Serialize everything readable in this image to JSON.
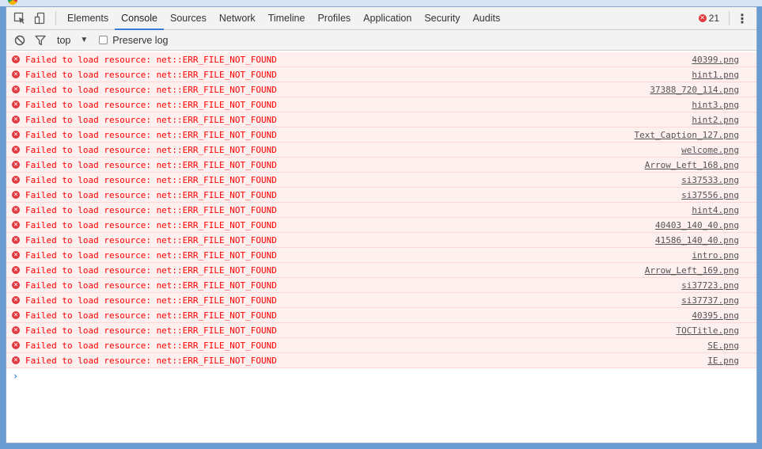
{
  "tabbar": {
    "tabs": [
      {
        "label": "Elements",
        "active": false
      },
      {
        "label": "Console",
        "active": true
      },
      {
        "label": "Sources",
        "active": false
      },
      {
        "label": "Network",
        "active": false
      },
      {
        "label": "Timeline",
        "active": false
      },
      {
        "label": "Profiles",
        "active": false
      },
      {
        "label": "Application",
        "active": false
      },
      {
        "label": "Security",
        "active": false
      },
      {
        "label": "Audits",
        "active": false
      }
    ],
    "error_count": "21",
    "icons": [
      "inspect-element-icon",
      "device-toolbar-icon",
      "more-menu-icon"
    ]
  },
  "console_toolbar": {
    "context": "top",
    "preserve_log_label": "Preserve log",
    "preserve_log_checked": false,
    "icons": [
      "clear-console-icon",
      "filter-icon",
      "dropdown-caret-icon"
    ]
  },
  "messages": [
    {
      "text": "Failed to load resource: net::ERR_FILE_NOT_FOUND",
      "source": "40399.png"
    },
    {
      "text": "Failed to load resource: net::ERR_FILE_NOT_FOUND",
      "source": "hint1.png"
    },
    {
      "text": "Failed to load resource: net::ERR_FILE_NOT_FOUND",
      "source": "37388_720_114.png"
    },
    {
      "text": "Failed to load resource: net::ERR_FILE_NOT_FOUND",
      "source": "hint3.png"
    },
    {
      "text": "Failed to load resource: net::ERR_FILE_NOT_FOUND",
      "source": "hint2.png"
    },
    {
      "text": "Failed to load resource: net::ERR_FILE_NOT_FOUND",
      "source": "Text_Caption_127.png"
    },
    {
      "text": "Failed to load resource: net::ERR_FILE_NOT_FOUND",
      "source": "welcome.png"
    },
    {
      "text": "Failed to load resource: net::ERR_FILE_NOT_FOUND",
      "source": "Arrow_Left_168.png"
    },
    {
      "text": "Failed to load resource: net::ERR_FILE_NOT_FOUND",
      "source": "si37533.png"
    },
    {
      "text": "Failed to load resource: net::ERR_FILE_NOT_FOUND",
      "source": "si37556.png"
    },
    {
      "text": "Failed to load resource: net::ERR_FILE_NOT_FOUND",
      "source": "hint4.png"
    },
    {
      "text": "Failed to load resource: net::ERR_FILE_NOT_FOUND",
      "source": "40403_140_40.png"
    },
    {
      "text": "Failed to load resource: net::ERR_FILE_NOT_FOUND",
      "source": "41586_140_40.png"
    },
    {
      "text": "Failed to load resource: net::ERR_FILE_NOT_FOUND",
      "source": "intro.png"
    },
    {
      "text": "Failed to load resource: net::ERR_FILE_NOT_FOUND",
      "source": "Arrow_Left_169.png"
    },
    {
      "text": "Failed to load resource: net::ERR_FILE_NOT_FOUND",
      "source": "si37723.png"
    },
    {
      "text": "Failed to load resource: net::ERR_FILE_NOT_FOUND",
      "source": "si37737.png"
    },
    {
      "text": "Failed to load resource: net::ERR_FILE_NOT_FOUND",
      "source": "40395.png"
    },
    {
      "text": "Failed to load resource: net::ERR_FILE_NOT_FOUND",
      "source": "TOCTitle.png"
    },
    {
      "text": "Failed to load resource: net::ERR_FILE_NOT_FOUND",
      "source": "SE.png"
    },
    {
      "text": "Failed to load resource: net::ERR_FILE_NOT_FOUND",
      "source": "IE.png"
    }
  ],
  "prompt_symbol": "›",
  "colors": {
    "error_text": "#ff0000",
    "error_bg": "#fff0f0",
    "error_border": "#ffd7d7",
    "active_tab": "#3879d9",
    "error_icon": "#e0383e"
  }
}
